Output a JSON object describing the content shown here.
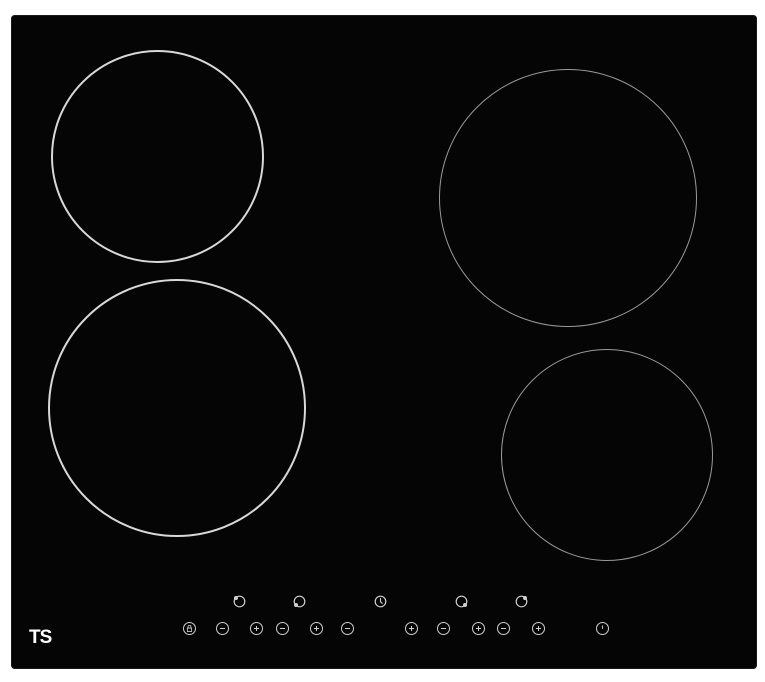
{
  "brand": {
    "logo_text": "TS"
  },
  "colors": {
    "glass": "#050505",
    "zone_ring_bright": "#d8d8d8",
    "zone_ring_dim": "#9a9a9a",
    "control_glyph": "#d0d0d0"
  },
  "cooking_zones": [
    {
      "name": "rear-left",
      "ring": "bright"
    },
    {
      "name": "front-left",
      "ring": "bright"
    },
    {
      "name": "rear-right",
      "ring": "dim"
    },
    {
      "name": "front-right",
      "ring": "dim"
    }
  ],
  "zone_indicators": [
    {
      "name": "zone-indicator-front-left",
      "icon": "zone-position-icon"
    },
    {
      "name": "zone-indicator-rear-left",
      "icon": "zone-position-icon"
    },
    {
      "name": "timer",
      "icon": "clock-icon"
    },
    {
      "name": "zone-indicator-rear-right",
      "icon": "zone-position-icon"
    },
    {
      "name": "zone-indicator-front-right",
      "icon": "zone-position-icon"
    }
  ],
  "touch_controls": [
    {
      "name": "child-lock-button",
      "icon": "lock-icon"
    },
    {
      "name": "zone1-minus-button",
      "icon": "minus-icon"
    },
    {
      "name": "zone1-plus-button",
      "icon": "plus-icon"
    },
    {
      "name": "zone2-minus-button",
      "icon": "minus-icon"
    },
    {
      "name": "zone2-plus-button",
      "icon": "plus-icon"
    },
    {
      "name": "timer-minus-button",
      "icon": "minus-icon"
    },
    {
      "name": "timer-plus-button",
      "icon": "plus-icon"
    },
    {
      "name": "zone3-minus-button",
      "icon": "minus-icon"
    },
    {
      "name": "zone3-plus-button",
      "icon": "plus-icon"
    },
    {
      "name": "zone4-minus-button",
      "icon": "minus-icon"
    },
    {
      "name": "zone4-plus-button",
      "icon": "plus-icon"
    },
    {
      "name": "power-button",
      "icon": "power-icon"
    }
  ]
}
